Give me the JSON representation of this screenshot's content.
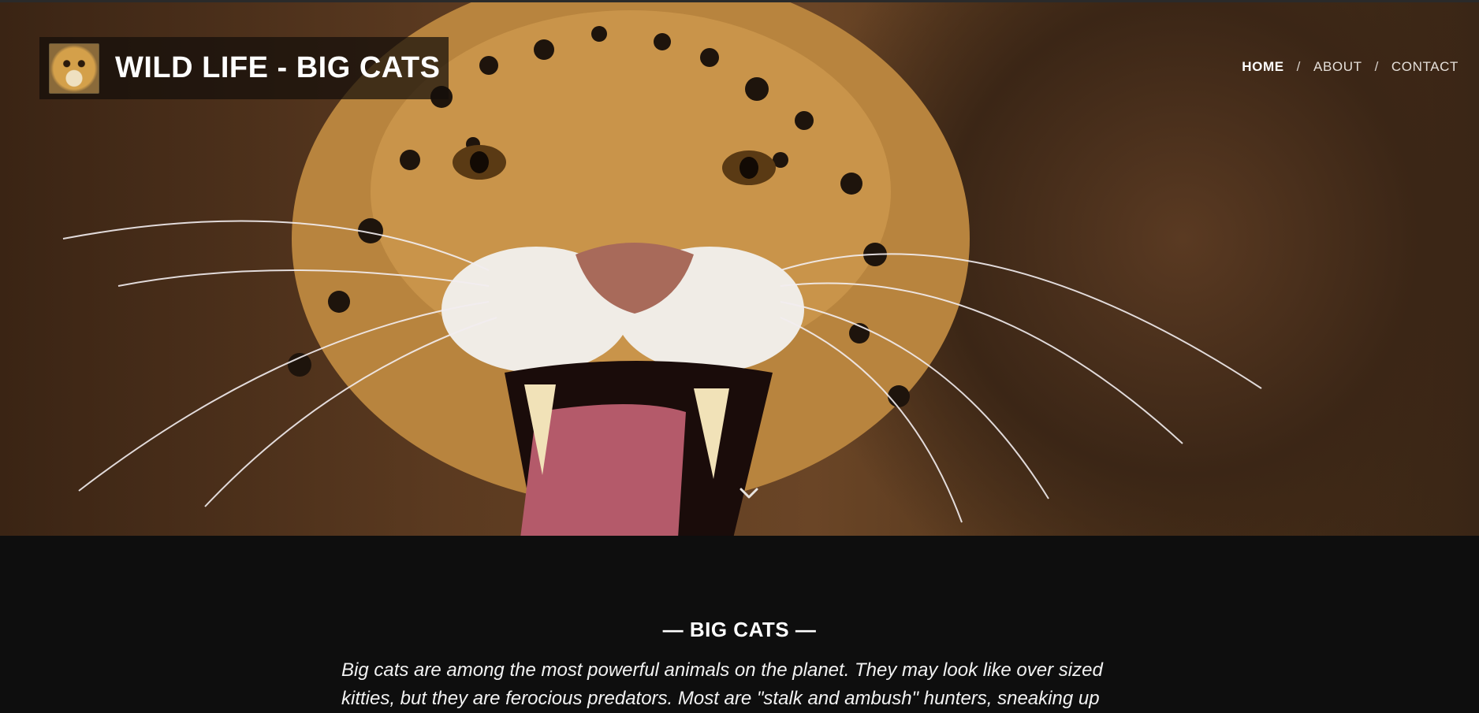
{
  "brand": {
    "title": "WILD LIFE - BIG CATS",
    "logo_icon": "jaguar-thumbnail-icon"
  },
  "nav": {
    "items": [
      {
        "label": "HOME",
        "active": true
      },
      {
        "label": "ABOUT",
        "active": false
      },
      {
        "label": "CONTACT",
        "active": false
      }
    ],
    "separator": "/"
  },
  "hero": {
    "scroll_icon": "chevron-down-icon"
  },
  "section": {
    "title": "— BIG CATS —",
    "text": "Big cats are among the most powerful animals on the planet. They may look like over sized kitties, but they are ferocious predators. Most are \"stalk and ambush\" hunters, sneaking up"
  },
  "colors": {
    "page_background": "#0e0e0e",
    "nav_text": "#e6e0da",
    "brand_panel": "#140e0a"
  }
}
